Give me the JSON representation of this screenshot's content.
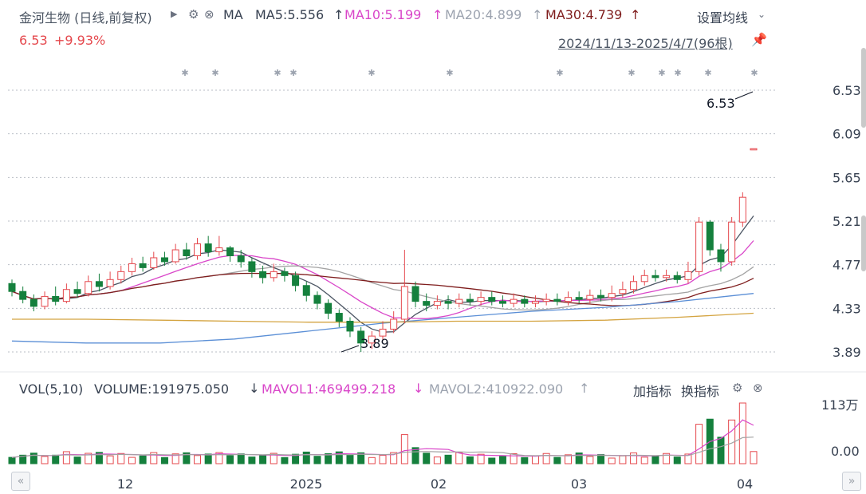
{
  "header": {
    "stock_title": "金河生物 (日线,前复权)",
    "indicator": "MA",
    "ma5": "MA5:5.556",
    "ma10": "MA10:5.199",
    "ma20": "MA20:4.899",
    "ma30": "MA30:4.739",
    "arrow_up": "↑",
    "price": "6.53",
    "change": "+9.93%",
    "settings_label": "设置均线",
    "date_range": "2024/11/13-2025/4/7(96根)"
  },
  "price_axis": [
    "6.53",
    "6.09",
    "5.65",
    "5.21",
    "4.77",
    "4.33",
    "3.89"
  ],
  "annotations": {
    "high_label": "6.53",
    "low_label": "3.89"
  },
  "volume_panel": {
    "label": "VOL(5,10)",
    "volume": "VOLUME:191975.050",
    "mavol1": "MAVOL1:469499.218",
    "mavol2": "MAVOL2:410922.090",
    "arrow_down": "↓",
    "arrow_up": "↑",
    "add_indicator": "加指标",
    "switch_indicator": "换指标",
    "axis_top": "113万",
    "axis_zero": "0.00"
  },
  "x_axis": [
    "12",
    "2025",
    "02",
    "03",
    "04"
  ],
  "colors": {
    "up": "#e5484d",
    "down": "#15803d",
    "ma5": "#4b5563",
    "ma10": "#d946c9",
    "ma20": "#a3a3a3",
    "ma30": "#7f1d1d",
    "ma60": "#5b8fd6",
    "ma120": "#d4a441"
  },
  "chart_data": {
    "type": "candlestick",
    "ylim": [
      3.89,
      6.53
    ],
    "candles": [
      [
        4.58,
        4.5,
        4.62,
        4.45
      ],
      [
        4.5,
        4.42,
        4.55,
        4.38
      ],
      [
        4.42,
        4.35,
        4.47,
        4.3
      ],
      [
        4.35,
        4.45,
        4.5,
        4.32
      ],
      [
        4.45,
        4.4,
        4.55,
        4.36
      ],
      [
        4.4,
        4.52,
        4.58,
        4.38
      ],
      [
        4.52,
        4.48,
        4.6,
        4.44
      ],
      [
        4.48,
        4.6,
        4.66,
        4.45
      ],
      [
        4.6,
        4.55,
        4.68,
        4.5
      ],
      [
        4.55,
        4.62,
        4.7,
        4.52
      ],
      [
        4.62,
        4.7,
        4.76,
        4.58
      ],
      [
        4.7,
        4.78,
        4.84,
        4.66
      ],
      [
        4.78,
        4.74,
        4.85,
        4.7
      ],
      [
        4.74,
        4.84,
        4.9,
        4.72
      ],
      [
        4.84,
        4.8,
        4.9,
        4.76
      ],
      [
        4.8,
        4.92,
        4.98,
        4.78
      ],
      [
        4.92,
        4.86,
        4.99,
        4.82
      ],
      [
        4.86,
        4.98,
        5.04,
        4.82
      ],
      [
        4.98,
        4.9,
        5.06,
        4.85
      ],
      [
        4.9,
        4.94,
        5.06,
        4.86
      ],
      [
        4.94,
        4.86,
        4.96,
        4.8
      ],
      [
        4.86,
        4.8,
        4.92,
        4.74
      ],
      [
        4.8,
        4.7,
        4.84,
        4.64
      ],
      [
        4.7,
        4.64,
        4.76,
        4.58
      ],
      [
        4.64,
        4.7,
        4.78,
        4.6
      ],
      [
        4.7,
        4.66,
        4.74,
        4.6
      ],
      [
        4.66,
        4.56,
        4.7,
        4.5
      ],
      [
        4.56,
        4.46,
        4.6,
        4.4
      ],
      [
        4.46,
        4.38,
        4.5,
        4.32
      ],
      [
        4.38,
        4.28,
        4.42,
        4.22
      ],
      [
        4.28,
        4.2,
        4.32,
        4.14
      ],
      [
        4.2,
        4.1,
        4.24,
        4.04
      ],
      [
        4.1,
        3.98,
        4.14,
        3.89
      ],
      [
        3.98,
        4.05,
        4.1,
        3.92
      ],
      [
        4.05,
        4.12,
        4.2,
        4.0
      ],
      [
        4.12,
        4.22,
        4.3,
        4.08
      ],
      [
        4.22,
        4.55,
        4.92,
        4.18
      ],
      [
        4.55,
        4.4,
        4.6,
        4.34
      ],
      [
        4.4,
        4.36,
        4.48,
        4.3
      ],
      [
        4.36,
        4.4,
        4.46,
        4.32
      ],
      [
        4.4,
        4.38,
        4.46,
        4.32
      ],
      [
        4.38,
        4.42,
        4.48,
        4.34
      ],
      [
        4.42,
        4.4,
        4.48,
        4.36
      ],
      [
        4.4,
        4.44,
        4.5,
        4.36
      ],
      [
        4.44,
        4.4,
        4.5,
        4.36
      ],
      [
        4.4,
        4.38,
        4.46,
        4.34
      ],
      [
        4.38,
        4.42,
        4.48,
        4.34
      ],
      [
        4.42,
        4.38,
        4.46,
        4.34
      ],
      [
        4.38,
        4.4,
        4.46,
        4.34
      ],
      [
        4.4,
        4.42,
        4.48,
        4.36
      ],
      [
        4.42,
        4.4,
        4.48,
        4.36
      ],
      [
        4.4,
        4.44,
        4.5,
        4.36
      ],
      [
        4.44,
        4.42,
        4.5,
        4.38
      ],
      [
        4.42,
        4.46,
        4.52,
        4.38
      ],
      [
        4.46,
        4.44,
        4.52,
        4.4
      ],
      [
        4.44,
        4.48,
        4.56,
        4.4
      ],
      [
        4.48,
        4.52,
        4.6,
        4.44
      ],
      [
        4.52,
        4.6,
        4.66,
        4.48
      ],
      [
        4.6,
        4.66,
        4.72,
        4.56
      ],
      [
        4.66,
        4.64,
        4.72,
        4.6
      ],
      [
        4.64,
        4.66,
        4.72,
        4.6
      ],
      [
        4.66,
        4.62,
        4.7,
        4.58
      ],
      [
        4.62,
        4.7,
        4.8,
        4.58
      ],
      [
        4.7,
        5.2,
        5.25,
        4.66
      ],
      [
        5.2,
        4.92,
        5.22,
        4.86
      ],
      [
        4.92,
        4.8,
        4.98,
        4.7
      ],
      [
        4.8,
        5.2,
        5.25,
        4.76
      ],
      [
        5.2,
        5.45,
        5.5,
        5.15
      ],
      [
        5.94,
        5.94,
        5.94,
        5.94
      ]
    ],
    "volume_max_label": "113万"
  }
}
